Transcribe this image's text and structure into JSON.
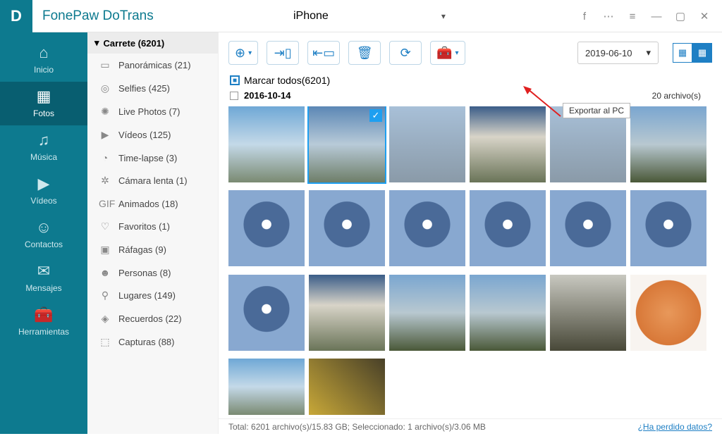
{
  "app": {
    "name": "FonePaw DoTrans"
  },
  "device": {
    "name": "iPhone"
  },
  "sidebar": {
    "items": [
      {
        "label": "Inicio"
      },
      {
        "label": "Fotos"
      },
      {
        "label": "Música"
      },
      {
        "label": "Vídeos"
      },
      {
        "label": "Contactos"
      },
      {
        "label": "Mensajes"
      },
      {
        "label": "Herramientas"
      }
    ]
  },
  "tree": {
    "header": "Carrete (6201)",
    "items": [
      {
        "label": "Panorámicas (21)"
      },
      {
        "label": "Selfies (425)"
      },
      {
        "label": "Live Photos (7)"
      },
      {
        "label": "Vídeos (125)"
      },
      {
        "label": "Time-lapse (3)"
      },
      {
        "label": "Cámara lenta (1)"
      },
      {
        "label": "Animados (18)"
      },
      {
        "label": "Favoritos (1)"
      },
      {
        "label": "Ráfagas (9)"
      },
      {
        "label": "Personas (8)"
      },
      {
        "label": "Lugares (149)"
      },
      {
        "label": "Recuerdos (22)"
      },
      {
        "label": "Capturas (88)"
      }
    ]
  },
  "toolbar": {
    "tooltip": "Exportar al PC",
    "date": "2019-06-10"
  },
  "selectall": {
    "label": "Marcar todos(6201)"
  },
  "group": {
    "date": "2016-10-14",
    "count": "20 archivo(s)"
  },
  "status": {
    "text": "Total: 6201 archivo(s)/15.83 GB; Seleccionado: 1 archivo(s)/3.06 MB",
    "link": "¿Ha perdido datos?"
  }
}
